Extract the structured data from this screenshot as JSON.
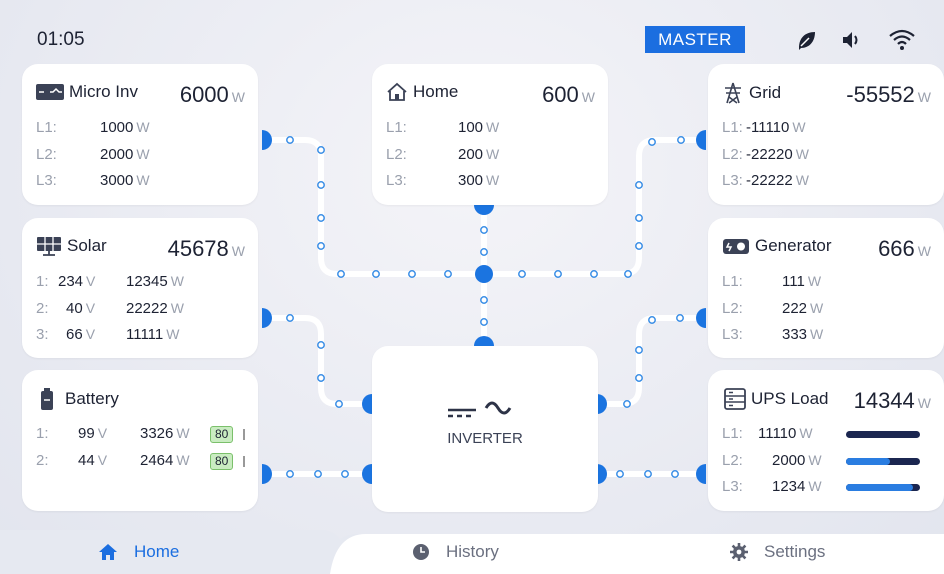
{
  "status": {
    "time": "01:05",
    "mode": "MASTER"
  },
  "status_icons": [
    "leaf-icon",
    "speaker-icon",
    "wifi-icon"
  ],
  "colors": {
    "accent": "#1b6ee0",
    "line": "#ffffff",
    "dot": "#3a8ee6",
    "battery_badge": "#c9ecc1",
    "ups_bar_bg": "#1b2650",
    "ups_bar_fill": "#2a7de1"
  },
  "micro_inv": {
    "title": "Micro Inv",
    "total": "6000",
    "unit": "W",
    "rows": [
      {
        "label": "L1:",
        "value": "1000",
        "unit": "W"
      },
      {
        "label": "L2:",
        "value": "2000",
        "unit": "W"
      },
      {
        "label": "L3:",
        "value": "3000",
        "unit": "W"
      }
    ]
  },
  "home": {
    "title": "Home",
    "total": "600",
    "unit": "W",
    "rows": [
      {
        "label": "L1:",
        "value": "100",
        "unit": "W"
      },
      {
        "label": "L2:",
        "value": "200",
        "unit": "W"
      },
      {
        "label": "L3:",
        "value": "300",
        "unit": "W"
      }
    ]
  },
  "grid": {
    "title": "Grid",
    "total": "-55552",
    "unit": "W",
    "rows": [
      {
        "label": "L1:",
        "value": "-11110",
        "unit": "W"
      },
      {
        "label": "L2:",
        "value": "-22220",
        "unit": "W"
      },
      {
        "label": "L3:",
        "value": "-22222",
        "unit": "W"
      }
    ]
  },
  "solar": {
    "title": "Solar",
    "total": "45678",
    "unit": "W",
    "rows": [
      {
        "label": "1:",
        "volt": "234",
        "vunit": "V",
        "power": "12345",
        "punit": "W"
      },
      {
        "label": "2:",
        "volt": "40",
        "vunit": "V",
        "power": "22222",
        "punit": "W"
      },
      {
        "label": "3:",
        "volt": "66",
        "vunit": "V",
        "power": "11111",
        "punit": "W"
      }
    ]
  },
  "generator": {
    "title": "Generator",
    "total": "666",
    "unit": "W",
    "rows": [
      {
        "label": "L1:",
        "value": "111",
        "unit": "W"
      },
      {
        "label": "L2:",
        "value": "222",
        "unit": "W"
      },
      {
        "label": "L3:",
        "value": "333",
        "unit": "W"
      }
    ]
  },
  "battery": {
    "title": "Battery",
    "rows": [
      {
        "label": "1:",
        "volt": "99",
        "vunit": "V",
        "power": "3326",
        "punit": "W",
        "soc": "80"
      },
      {
        "label": "2:",
        "volt": "44",
        "vunit": "V",
        "power": "2464",
        "punit": "W",
        "soc": "80"
      }
    ]
  },
  "ups": {
    "title": "UPS Load",
    "total": "14344",
    "unit": "W",
    "rows": [
      {
        "label": "L1:",
        "value": "11110",
        "unit": "W",
        "level": 0.0
      },
      {
        "label": "L2:",
        "value": "2000",
        "unit": "W",
        "level": 0.6
      },
      {
        "label": "L3:",
        "value": "1234",
        "unit": "W",
        "level": 0.9
      }
    ]
  },
  "inverter": {
    "label": "INVERTER",
    "symbol": "⎓ ∼"
  },
  "tabs": [
    {
      "label": "Home",
      "icon": "home-icon",
      "active": true
    },
    {
      "label": "History",
      "icon": "clock-icon",
      "active": false
    },
    {
      "label": "Settings",
      "icon": "gear-icon",
      "active": false
    }
  ]
}
